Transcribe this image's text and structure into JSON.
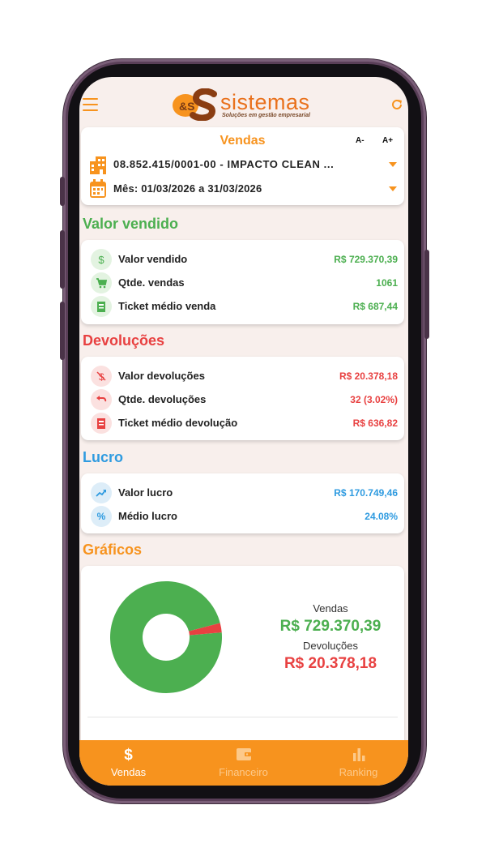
{
  "header": {
    "logo_mark": "&S",
    "brand": "sistemas",
    "tagline": "Soluções em gestão empresarial"
  },
  "filter": {
    "title": "Vendas",
    "font_decrease": "A-",
    "font_increase": "A+",
    "company": "08.852.415/0001-00 - IMPACTO CLEAN ...",
    "period": "Mês: 01/03/2026 a 31/03/2026"
  },
  "sections": {
    "sales": {
      "title": "Valor vendido",
      "rows": [
        {
          "label": "Valor vendido",
          "value": "R$ 729.370,39"
        },
        {
          "label": "Qtde. vendas",
          "value": "1061"
        },
        {
          "label": "Ticket médio venda",
          "value": "R$ 687,44"
        }
      ]
    },
    "returns": {
      "title": "Devoluções",
      "rows": [
        {
          "label": "Valor devoluções",
          "value": "R$ 20.378,18"
        },
        {
          "label": "Qtde. devoluções",
          "value": "32 (3.02%)"
        },
        {
          "label": "Ticket médio devolução",
          "value": "R$ 636,82"
        }
      ]
    },
    "profit": {
      "title": "Lucro",
      "rows": [
        {
          "label": "Valor lucro",
          "value": "R$ 170.749,46"
        },
        {
          "label": "Médio lucro",
          "value": "24.08%"
        }
      ]
    },
    "charts": {
      "title": "Gráficos",
      "legend": {
        "sales_label": "Vendas",
        "sales_value": "R$ 729.370,39",
        "returns_label": "Devoluções",
        "returns_value": "R$ 20.378,18"
      }
    }
  },
  "chart_data": {
    "type": "pie",
    "categories": [
      "Vendas",
      "Devoluções"
    ],
    "values": [
      729370.39,
      20378.18
    ],
    "colors": [
      "#4caf50",
      "#e84141"
    ]
  },
  "bottom_nav": {
    "items": [
      {
        "label": "Vendas",
        "icon": "dollar-icon",
        "active": true
      },
      {
        "label": "Financeiro",
        "icon": "wallet-icon",
        "active": false
      },
      {
        "label": "Ranking",
        "icon": "bar-chart-icon",
        "active": false
      }
    ]
  },
  "colors": {
    "accent": "#f7931e",
    "green": "#4caf50",
    "red": "#e84141",
    "blue": "#2f9be0",
    "background": "#f8efec"
  }
}
